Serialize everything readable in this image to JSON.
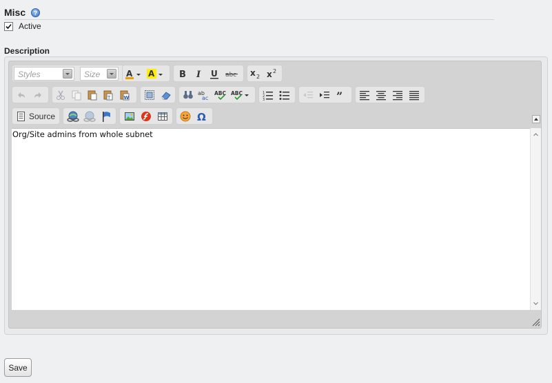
{
  "section": {
    "title": "Misc",
    "help_icon": "help-icon"
  },
  "active": {
    "label": "Active",
    "checked": true
  },
  "description": {
    "label": "Description"
  },
  "editor": {
    "styles_placeholder": "Styles",
    "size_placeholder": "Size",
    "source_label": "Source",
    "content": "Org/Site admins from whole subnet",
    "toolbar_icons": [
      "text-color-icon",
      "background-color-icon",
      "bold-icon",
      "italic-icon",
      "underline-icon",
      "strikethrough-icon",
      "subscript-icon",
      "superscript-icon",
      "undo-icon",
      "redo-icon",
      "cut-icon",
      "copy-icon",
      "paste-icon",
      "paste-text-icon",
      "paste-word-icon",
      "select-all-icon",
      "remove-format-icon",
      "find-icon",
      "replace-icon",
      "spellcheck-icon",
      "spell-as-you-type-icon",
      "numbered-list-icon",
      "bulleted-list-icon",
      "outdent-icon",
      "indent-icon",
      "blockquote-icon",
      "align-left-icon",
      "align-center-icon",
      "align-right-icon",
      "justify-icon",
      "source-icon",
      "link-icon",
      "unlink-icon",
      "anchor-icon",
      "image-icon",
      "flash-icon",
      "table-icon",
      "smiley-icon",
      "special-char-icon"
    ]
  },
  "colors": {
    "background": "#eef0f2",
    "toolbar": "#e6e6e6",
    "editor_frame": "#d3d3d3"
  },
  "save": {
    "label": "Save"
  }
}
